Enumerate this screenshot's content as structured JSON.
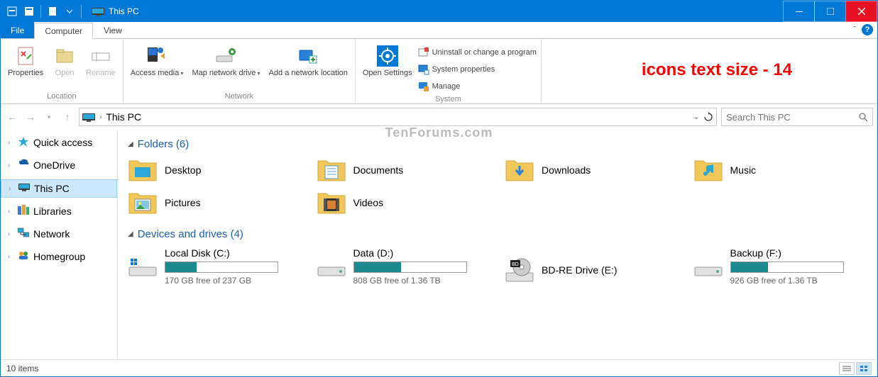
{
  "title": "This PC",
  "annotation": "icons text size - 14",
  "watermark": "TenForums.com",
  "tabs": {
    "file": "File",
    "computer": "Computer",
    "view": "View"
  },
  "ribbon": {
    "location": {
      "label": "Location",
      "properties": "Properties",
      "open": "Open",
      "rename": "Rename"
    },
    "network": {
      "label": "Network",
      "access_media": "Access media",
      "map_drive": "Map network drive",
      "add_loc": "Add a network location"
    },
    "system": {
      "label": "System",
      "open_settings": "Open Settings",
      "uninstall": "Uninstall or change a program",
      "sysprops": "System properties",
      "manage": "Manage"
    }
  },
  "address": {
    "path": "This PC"
  },
  "search": {
    "placeholder": "Search This PC"
  },
  "sidebar": {
    "quick_access": "Quick access",
    "onedrive": "OneDrive",
    "this_pc": "This PC",
    "libraries": "Libraries",
    "network": "Network",
    "homegroup": "Homegroup"
  },
  "sections": {
    "folders": {
      "title": "Folders (6)"
    },
    "drives": {
      "title": "Devices and drives (4)"
    }
  },
  "folders": [
    {
      "name": "Desktop"
    },
    {
      "name": "Documents"
    },
    {
      "name": "Downloads"
    },
    {
      "name": "Music"
    },
    {
      "name": "Pictures"
    },
    {
      "name": "Videos"
    }
  ],
  "drives": [
    {
      "name": "Local Disk (C:)",
      "free": "170 GB free of 237 GB",
      "fill_pct": 28
    },
    {
      "name": "Data (D:)",
      "free": "808 GB free of 1.36 TB",
      "fill_pct": 42
    },
    {
      "name": "BD-RE Drive (E:)",
      "simple": true
    },
    {
      "name": "Backup (F:)",
      "free": "926 GB free of 1.36 TB",
      "fill_pct": 33
    }
  ],
  "status": {
    "items": "10 items"
  }
}
